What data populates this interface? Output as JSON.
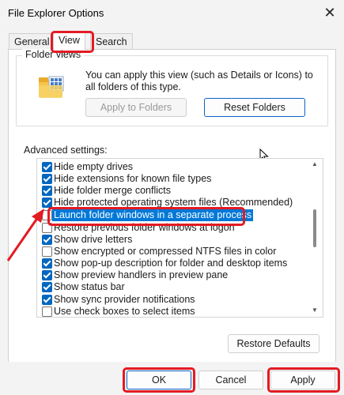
{
  "window": {
    "title": "File Explorer Options",
    "close_glyph": "✕"
  },
  "tabs": [
    {
      "label": "General",
      "active": false
    },
    {
      "label": "View",
      "active": true
    },
    {
      "label": "Search",
      "active": false
    }
  ],
  "folder_views": {
    "legend": "Folder views",
    "description": "You can apply this view (such as Details or Icons) to all folders of this type.",
    "apply_button": "Apply to Folders",
    "reset_button": "Reset Folders"
  },
  "advanced": {
    "label": "Advanced settings:",
    "items": [
      {
        "label": "Hide empty drives",
        "checked": true
      },
      {
        "label": "Hide extensions for known file types",
        "checked": true
      },
      {
        "label": "Hide folder merge conflicts",
        "checked": true
      },
      {
        "label": "Hide protected operating system files (Recommended)",
        "checked": true
      },
      {
        "label": "Launch folder windows in a separate process",
        "checked": false,
        "selected": true
      },
      {
        "label": "Restore previous folder windows at logon",
        "checked": false
      },
      {
        "label": "Show drive letters",
        "checked": true
      },
      {
        "label": "Show encrypted or compressed NTFS files in color",
        "checked": false
      },
      {
        "label": "Show pop-up description for folder and desktop items",
        "checked": true
      },
      {
        "label": "Show preview handlers in preview pane",
        "checked": true
      },
      {
        "label": "Show status bar",
        "checked": true
      },
      {
        "label": "Show sync provider notifications",
        "checked": true
      },
      {
        "label": "Use check boxes to select items",
        "checked": false
      }
    ],
    "restore_defaults": "Restore Defaults"
  },
  "footer": {
    "ok": "OK",
    "cancel": "Cancel",
    "apply": "Apply"
  },
  "colors": {
    "accent": "#0067c0",
    "selection": "#0078d7",
    "annotation": "#e31b23"
  }
}
